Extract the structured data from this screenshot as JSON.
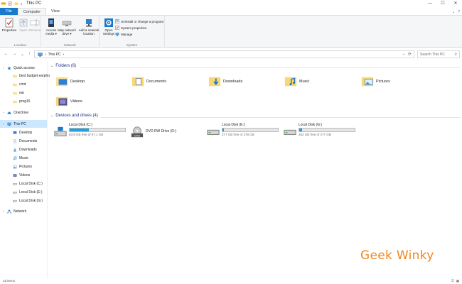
{
  "window": {
    "title": "This PC",
    "controls": [
      "—",
      "☐",
      "✕"
    ]
  },
  "ribbon_tabs": {
    "file": "File",
    "computer": "Computer",
    "view": "View"
  },
  "ribbon": {
    "location": {
      "label": "Location",
      "properties": "Properties",
      "open": "Open",
      "rename": "Rename"
    },
    "network": {
      "label": "Network",
      "access_media": "Access\nmedia ▾",
      "map_drive": "Map network\ndrive ▾",
      "add_location": "Add a network\nlocation"
    },
    "system": {
      "label": "System",
      "open_settings": "Open\nSettings",
      "uninstall": "Uninstall or change a program",
      "system_properties": "System properties",
      "manage": "Manage"
    }
  },
  "address": {
    "path_root": "This PC",
    "separator": "›",
    "search_placeholder": "Search This PC"
  },
  "sidebar": {
    "items": [
      {
        "label": "Quick access",
        "icon": "star-icon",
        "level": 0
      },
      {
        "label": "best budget earpho",
        "icon": "folder-icon",
        "level": 1
      },
      {
        "label": "cmd",
        "icon": "folder-icon",
        "level": 1
      },
      {
        "label": "ear",
        "icon": "folder-icon",
        "level": 1
      },
      {
        "label": "prog16",
        "icon": "folder-icon",
        "level": 1
      },
      {
        "label": "OneDrive",
        "icon": "cloud-icon",
        "level": 0
      },
      {
        "label": "This PC",
        "icon": "computer-icon",
        "level": 0,
        "selected": true
      },
      {
        "label": "Desktop",
        "icon": "desktop-icon",
        "level": 1
      },
      {
        "label": "Documents",
        "icon": "documents-icon",
        "level": 1
      },
      {
        "label": "Downloads",
        "icon": "downloads-icon",
        "level": 1
      },
      {
        "label": "Music",
        "icon": "music-icon",
        "level": 1
      },
      {
        "label": "Pictures",
        "icon": "pictures-icon",
        "level": 1
      },
      {
        "label": "Videos",
        "icon": "videos-icon",
        "level": 1
      },
      {
        "label": "Local Disk (C:)",
        "icon": "drive-icon",
        "level": 1
      },
      {
        "label": "Local Disk (E:)",
        "icon": "drive-icon",
        "level": 1
      },
      {
        "label": "Local Disk (G:)",
        "icon": "drive-icon",
        "level": 1
      },
      {
        "label": "Network",
        "icon": "network-icon",
        "level": 0
      }
    ]
  },
  "folders": {
    "header": "Folders (6)",
    "items": [
      {
        "name": "Desktop",
        "icon": "desktop-folder-icon"
      },
      {
        "name": "Documents",
        "icon": "documents-folder-icon"
      },
      {
        "name": "Downloads",
        "icon": "downloads-folder-icon"
      },
      {
        "name": "Music",
        "icon": "music-folder-icon"
      },
      {
        "name": "Pictures",
        "icon": "pictures-folder-icon"
      },
      {
        "name": "Videos",
        "icon": "videos-folder-icon"
      }
    ]
  },
  "drives": {
    "header": "Devices and drives (4)",
    "items": [
      {
        "name": "Local Disk (C:)",
        "free": "63.9 GB free of 97.1 GB",
        "used_fraction": 0.34,
        "icon": "os-drive-icon"
      },
      {
        "name": "DVD RW Drive (D:)",
        "free": "",
        "used_fraction": null,
        "icon": "dvd-drive-icon"
      },
      {
        "name": "Local Disk (E:)",
        "free": "277 GB free of 278 GB",
        "used_fraction": 0.004,
        "icon": "drive-icon"
      },
      {
        "name": "Local Disk (G:)",
        "free": "262 GB free of 277 GB",
        "used_fraction": 0.054,
        "icon": "drive-icon"
      }
    ]
  },
  "watermark": "Geek Winky",
  "status": {
    "items_count": "15 items"
  },
  "colors": {
    "accent": "#1979ca",
    "selection": "#cce8ff",
    "drive_bar": "#26a0da",
    "folder_yellow": "#f8d775",
    "watermark": "#f0871f"
  }
}
